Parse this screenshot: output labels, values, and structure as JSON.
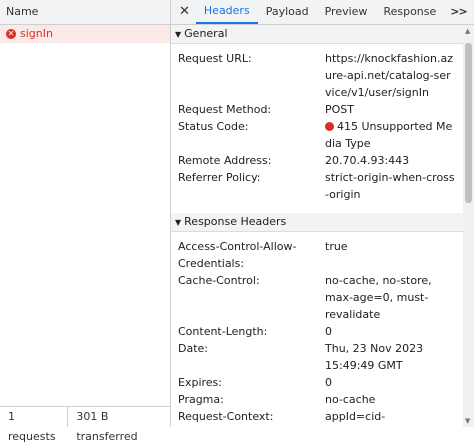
{
  "left": {
    "header": "Name",
    "request_name": "signIn",
    "footer_requests": "1 requests",
    "footer_transferred": "301 B transferred"
  },
  "tabs": {
    "close": "✕",
    "headers": "Headers",
    "payload": "Payload",
    "preview": "Preview",
    "response": "Response",
    "more": ">>"
  },
  "general": {
    "title": "General",
    "request_url_key": "Request URL:",
    "request_url": "https://knockfashion.azure-api.net/catalog-service/v1/user/signIn",
    "request_method_key": "Request Method:",
    "request_method": "POST",
    "status_code_key": "Status Code:",
    "status_code": "415 Unsupported Media Type",
    "remote_address_key": "Remote Address:",
    "remote_address": "20.70.4.93:443",
    "referrer_policy_key": "Referrer Policy:",
    "referrer_policy": "strict-origin-when-cross-origin"
  },
  "response_headers": {
    "title": "Response Headers",
    "acac_key": "Access-Control-Allow-Credentials:",
    "acac": "true",
    "cache_control_key": "Cache-Control:",
    "cache_control": "no-cache, no-store, max-age=0, must-revalidate",
    "content_length_key": "Content-Length:",
    "content_length": "0",
    "date_key": "Date:",
    "date": "Thu, 23 Nov 2023 15:49:49 GMT",
    "expires_key": "Expires:",
    "expires": "0",
    "pragma_key": "Pragma:",
    "pragma": "no-cache",
    "request_context_key": "Request-Context:",
    "request_context": "appId=cid-"
  },
  "colors": {
    "accent": "#1a73e8",
    "error": "#d93025"
  }
}
